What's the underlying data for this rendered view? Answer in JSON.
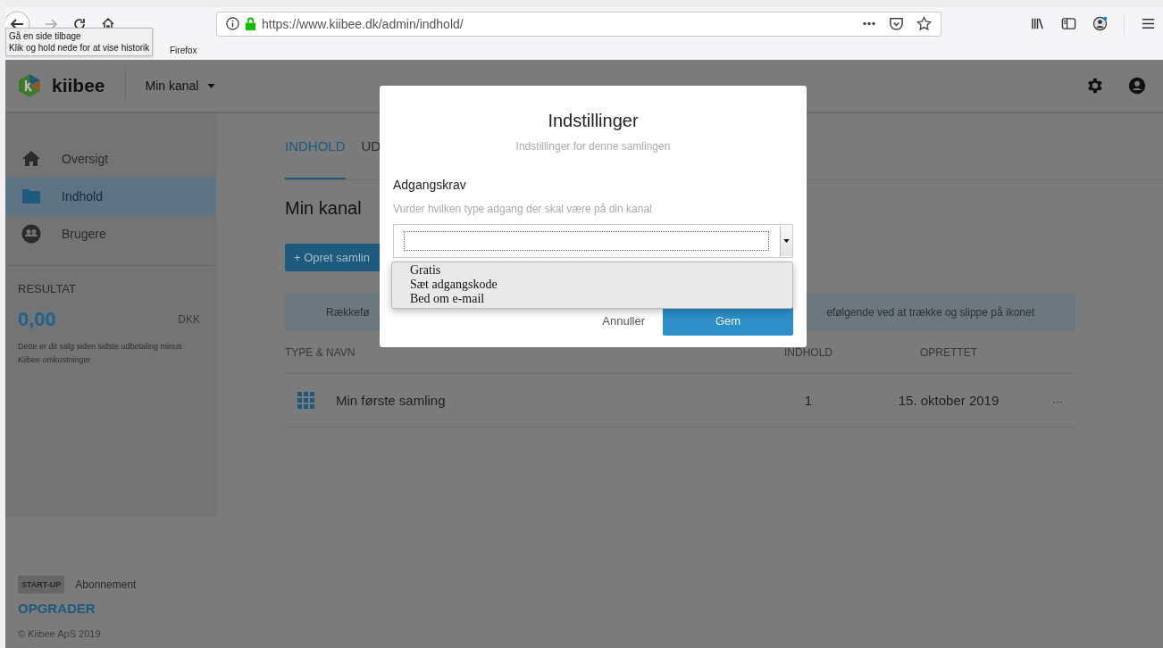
{
  "browser": {
    "url": "https://www.kiibee.dk/admin/indhold/",
    "bookmark": "Firefox",
    "tooltip": [
      "Gå en side tilbage",
      "Klik og hold nede for at vise historik"
    ]
  },
  "header": {
    "logo": "kiibee",
    "channel": "Min kanal"
  },
  "sidebar": {
    "items": [
      {
        "label": "Oversigt",
        "selected": false
      },
      {
        "label": "Indhold",
        "selected": true
      },
      {
        "label": "Brugere",
        "selected": false
      }
    ],
    "result": {
      "title": "RESULTAT",
      "amount": "0,00",
      "currency": "DKK",
      "note": "Dette er dit salg siden sidste udbetaling minus Kiibee omkostninger"
    },
    "plan": {
      "badge": "START-UP",
      "label": "Abonnement",
      "upgrade": "OPGRADER",
      "copyright": "© Kiibee ApS 2019"
    }
  },
  "main": {
    "tabs": [
      {
        "label": "INDHOLD",
        "selected": true
      },
      {
        "label": "UD",
        "selected": false
      }
    ],
    "title": "Min kanal",
    "create_button": "+ Opret samlin",
    "info": [
      "Rækkefø",
      "efølgende ved at trække og slippe på ikonet"
    ],
    "table": {
      "columns": [
        "TYPE & NAVN",
        "INDHOLD",
        "OPRETTET"
      ],
      "rows": [
        {
          "name": "Min første samling",
          "count": "1",
          "created": "15. oktober 2019",
          "menu": "···"
        }
      ]
    }
  },
  "dialog": {
    "title": "Indstillinger",
    "subtitle": "Indstillinger for denne samlingen",
    "field_label": "Adgangskrav",
    "hint": "Vurder hvilken type adgang der skal være på din kanal",
    "options": [
      "Gratis",
      "Sæt adgangskode",
      "Bed om e-mail"
    ],
    "buttons": {
      "cancel": "Annuller",
      "save": "Gem"
    }
  }
}
